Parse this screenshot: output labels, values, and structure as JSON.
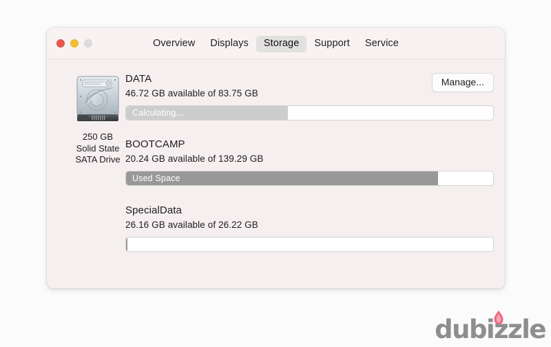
{
  "window": {
    "traffic_lights": [
      {
        "name": "close",
        "color": "#e9564c"
      },
      {
        "name": "minimize",
        "color": "#f2bf34"
      },
      {
        "name": "maximize",
        "color": "#dcdcdc"
      }
    ],
    "tabs": [
      {
        "label": "Overview",
        "selected": false
      },
      {
        "label": "Displays",
        "selected": false
      },
      {
        "label": "Storage",
        "selected": true
      },
      {
        "label": "Support",
        "selected": false
      },
      {
        "label": "Service",
        "selected": false
      }
    ]
  },
  "drive": {
    "icon": "internal-hard-drive-icon",
    "capacity": "250 GB",
    "type": "Solid State",
    "interface": "SATA Drive"
  },
  "toolbar": {
    "manage_label": "Manage..."
  },
  "volumes": [
    {
      "name": "DATA",
      "detail": "46.72 GB available of 83.75 GB",
      "bar_label": "Calculating...",
      "fill_percent": 44,
      "fill_style": "light",
      "fill_color": "#cdcdcd"
    },
    {
      "name": "BOOTCAMP",
      "detail": "20.24 GB available of 139.29 GB",
      "bar_label": "Used Space",
      "fill_percent": 85,
      "fill_style": "dark",
      "fill_color": "#989898"
    },
    {
      "name": "SpecialData",
      "detail": "26.16 GB available of 26.22 GB",
      "bar_label": "",
      "fill_percent": 0.4,
      "fill_style": "dark",
      "fill_color": "#989898"
    }
  ],
  "watermark": {
    "text": "dubizzle",
    "flame_color": "#ec5f72",
    "text_color": "#8e8e8e"
  }
}
